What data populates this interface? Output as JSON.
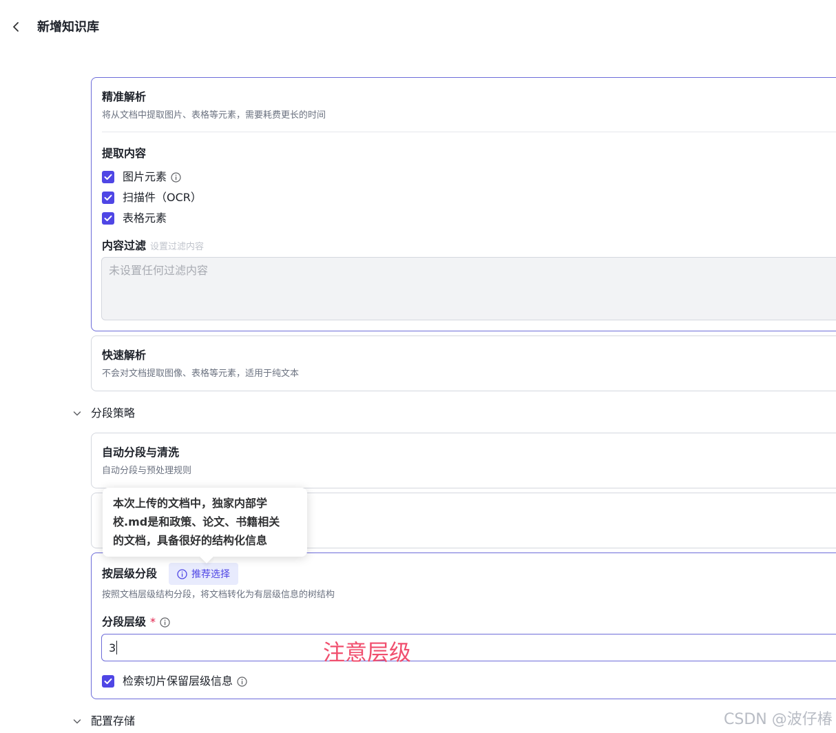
{
  "header": {
    "back_icon": "chevron-left-icon",
    "title": "新增知识库"
  },
  "parse_precise": {
    "title": "精准解析",
    "desc": "将从文档中提取图片、表格等元素，需要耗费更长的时间",
    "extract": {
      "label": "提取内容",
      "options": [
        {
          "label": "图片元素",
          "checked": true,
          "has_info": true
        },
        {
          "label": "扫描件（OCR）",
          "checked": true,
          "has_info": false
        },
        {
          "label": "表格元素",
          "checked": true,
          "has_info": false
        }
      ]
    },
    "filter": {
      "label": "内容过滤",
      "hint": "设置过滤内容",
      "placeholder": "未设置任何过滤内容"
    }
  },
  "parse_fast": {
    "title": "快速解析",
    "desc": "不会对文档提取图像、表格等元素，适用于纯文本"
  },
  "segment": {
    "label": "分段策略",
    "auto": {
      "title": "自动分段与清洗",
      "desc": "自动分段与预处理规则"
    },
    "hierarchy": {
      "title": "按层级分段",
      "tag": "推荐选择",
      "desc": "按照文档层级结构分段，将文档转化为有层级信息的树结构",
      "level_label": "分段层级",
      "required_mark": "*",
      "level_value": "3",
      "keep_info_label": "检索切片保留层级信息",
      "keep_info_checked": true
    }
  },
  "storage": {
    "label": "配置存储"
  },
  "tooltip": {
    "lines": [
      "本次上传的文档中，独家内部学",
      "校.md是和政策、论文、书籍相关",
      "的文档，具备很好的结构化信息"
    ]
  },
  "annotation": "注意层级",
  "watermark": "CSDN @波仔椿",
  "colors": {
    "accent": "#4f46e5",
    "selected_border": "#6c6bd9",
    "annotation": "#f04f6e"
  }
}
